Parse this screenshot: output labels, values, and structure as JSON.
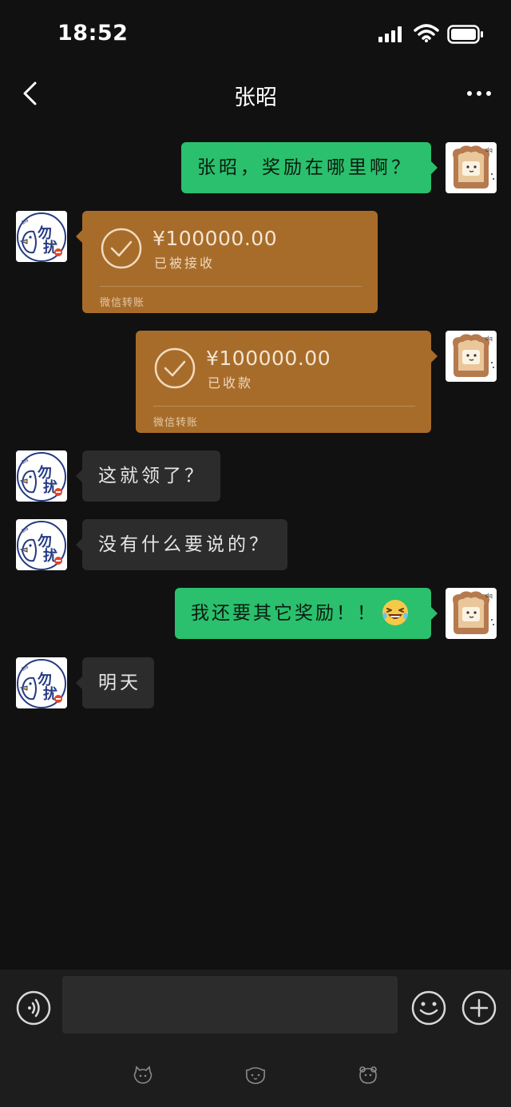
{
  "status_bar": {
    "time": "18:52"
  },
  "nav": {
    "title": "张昭",
    "back_icon": "chevron-left-icon",
    "more_icon": "more-icon"
  },
  "messages": [
    {
      "side": "self",
      "type": "text",
      "text": "张昭，奖励在哪里啊？"
    },
    {
      "side": "other",
      "type": "transfer",
      "amount": "¥100000.00",
      "status": "已被接收",
      "footer": "微信转账"
    },
    {
      "side": "self",
      "type": "transfer",
      "amount": "¥100000.00",
      "status": "已收款",
      "footer": "微信转账"
    },
    {
      "side": "other",
      "type": "text",
      "text": "这就领了？"
    },
    {
      "side": "other",
      "type": "text",
      "text": "没有什么要说的？"
    },
    {
      "side": "self",
      "type": "text",
      "text": "我还要其它奖励！！",
      "emoji": "laughing-squint-emoji"
    },
    {
      "side": "other",
      "type": "text",
      "text": "明天"
    }
  ],
  "input_bar": {
    "value": "",
    "icons": [
      "voice-icon",
      "emoji-icon",
      "plus-icon"
    ]
  },
  "colors": {
    "background": "#111111",
    "self_bubble": "#2ac06d",
    "other_bubble": "#2c2c2c",
    "transfer_card": "#a86c2a",
    "input_bar": "#1d1d1d"
  }
}
